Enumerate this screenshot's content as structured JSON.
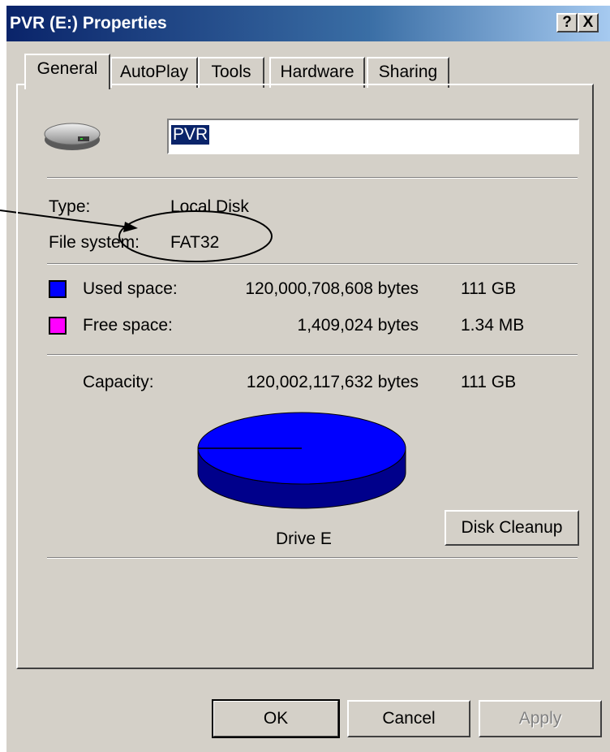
{
  "window": {
    "title": "PVR (E:) Properties",
    "help_label": "?",
    "close_label": "X"
  },
  "tabs": [
    "General",
    "AutoPlay",
    "Tools",
    "Hardware",
    "Sharing"
  ],
  "active_tab": "General",
  "drive": {
    "name": "PVR"
  },
  "info": {
    "type_label": "Type:",
    "type_value": "Local Disk",
    "fs_label": "File system:",
    "fs_value": "FAT32"
  },
  "space": {
    "used_label": "Used space:",
    "used_bytes": "120,000,708,608 bytes",
    "used_size": "111 GB",
    "free_label": "Free space:",
    "free_bytes": "1,409,024 bytes",
    "free_size": "1.34 MB",
    "capacity_label": "Capacity:",
    "capacity_bytes": "120,002,117,632 bytes",
    "capacity_size": "111 GB",
    "used_fraction": 0.99999
  },
  "chart_label": "Drive E",
  "buttons": {
    "disk_cleanup": "Disk Cleanup",
    "ok": "OK",
    "cancel": "Cancel",
    "apply": "Apply"
  },
  "colors": {
    "used": "#0000ff",
    "free": "#ff00ff",
    "title_bar": "#0a246a",
    "face": "#d4d0c8"
  },
  "icons": {
    "drive": "hard-drive-icon"
  }
}
